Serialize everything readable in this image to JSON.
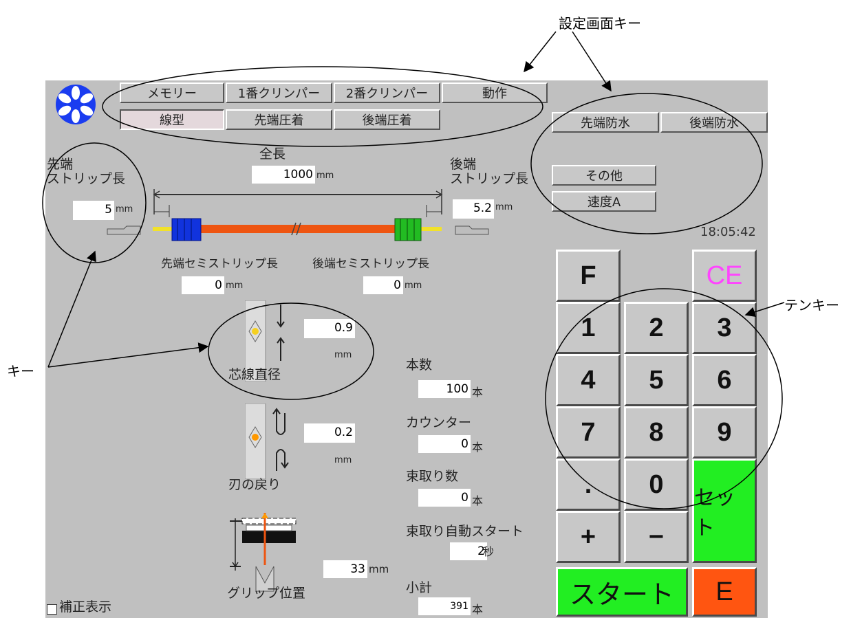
{
  "annotations": {
    "setting_keys": "設定画面キー",
    "tenkey": "テンキー",
    "key": "キー"
  },
  "tabs_row1": [
    "メモリー",
    "1番クリンパー",
    "2番クリンパー",
    "動作"
  ],
  "tabs_row2": [
    "線型",
    "先端圧着",
    "後端圧着"
  ],
  "tabs_right": [
    "先端防水",
    "後端防水"
  ],
  "side_buttons": [
    "その他",
    "速度A"
  ],
  "clock": "18:05:42",
  "wire": {
    "total_length_label": "全長",
    "total_length_value": "1000",
    "unit_mm": "mm",
    "front_strip_label_1": "先端",
    "front_strip_label_2": "ストリップ長",
    "front_strip_value": "5",
    "rear_strip_label_1": "後端",
    "rear_strip_label_2": "ストリップ長",
    "rear_strip_value": "5.2",
    "front_semistrip_label": "先端セミストリップ長",
    "front_semistrip_value": "0",
    "rear_semistrip_label": "後端セミストリップ長",
    "rear_semistrip_value": "0"
  },
  "core_diameter": {
    "label": "芯線直径",
    "value": "0.9",
    "unit": "mm"
  },
  "blade_return": {
    "label": "刃の戻り",
    "value": "0.2",
    "unit": "mm"
  },
  "grip_position": {
    "label": "グリップ位置",
    "value": "33",
    "unit": "mm"
  },
  "counters": {
    "count_label": "本数",
    "count_value": "100",
    "unit_pcs": "本",
    "counter_label": "カウンター",
    "counter_value": "0",
    "bundle_label": "束取り数",
    "bundle_value": "0",
    "auto_start_label": "束取り自動スタート",
    "auto_start_value": "2",
    "unit_sec": "秒",
    "subtotal_label": "小計",
    "subtotal_value": "391"
  },
  "keypad": {
    "f": "F",
    "ce": "CE",
    "k1": "1",
    "k2": "2",
    "k3": "3",
    "k4": "4",
    "k5": "5",
    "k6": "6",
    "k7": "7",
    "k8": "8",
    "k9": "9",
    "dot": ".",
    "k0": "0",
    "set": "セット",
    "plus": "+",
    "minus": "−",
    "start": "スタート",
    "e": "E"
  },
  "correction_display": "補正表示",
  "colors": {
    "panel": "#c0c0c0",
    "green": "#22ee22",
    "orange": "#ff5511",
    "ce_pink": "#ff44ff",
    "logo_blue": "#1a3cf0"
  }
}
